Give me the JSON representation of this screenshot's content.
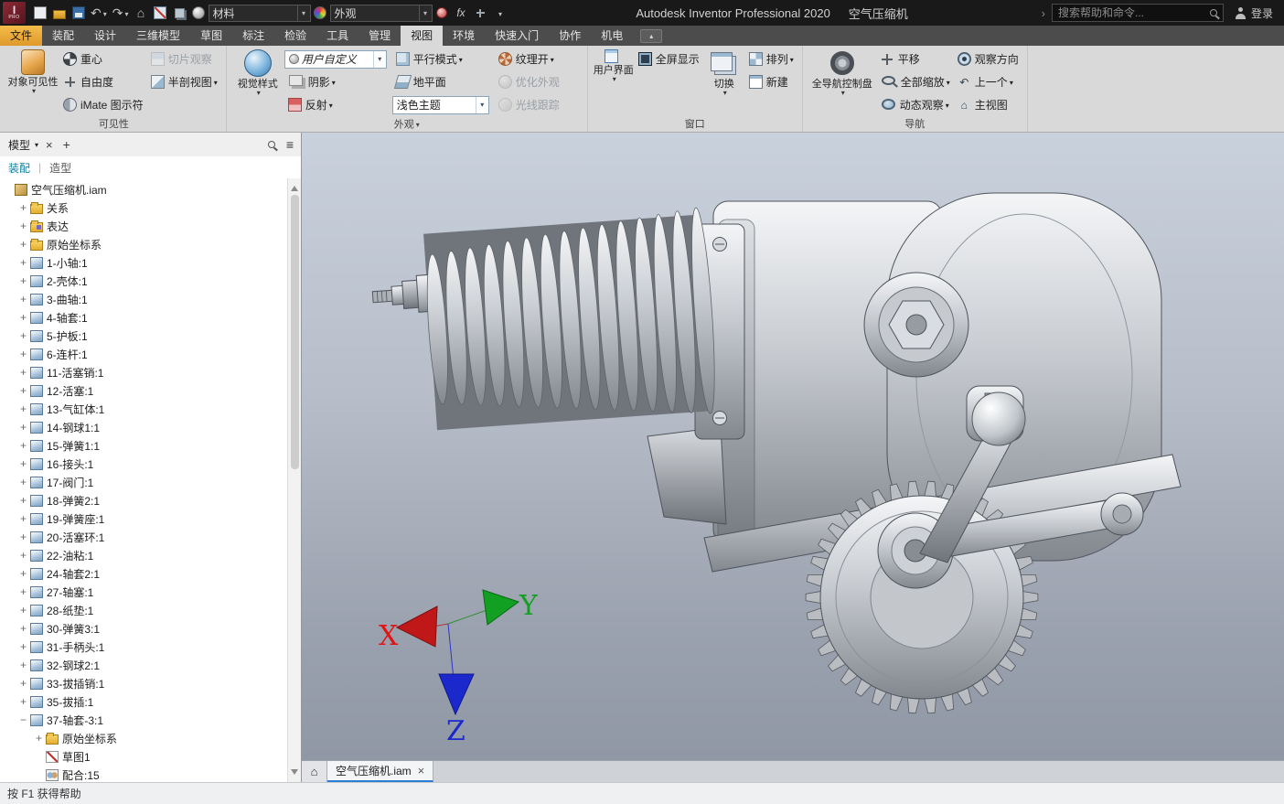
{
  "icons": {
    "home": "⌂",
    "undo": "↶",
    "redo": "↷",
    "fx": "fx",
    "hamburger": "≡",
    "close": "×",
    "add": "+",
    "chevron": "›",
    "collapse": "▴"
  },
  "colors": {
    "file_tab": "#e8a33d",
    "active_subtab": "#0a7e9e",
    "triad_x": "#e01616",
    "triad_y": "#12a022",
    "triad_z": "#1a28cc"
  },
  "titlebar": {
    "app_title": "Autodesk Inventor Professional 2020",
    "doc_title": "空气压缩机",
    "material_combo": "材料",
    "appearance_combo": "外观",
    "search_placeholder": "搜索帮助和命令...",
    "sign_in": "登录"
  },
  "ribbon": {
    "tabs": [
      "文件",
      "装配",
      "设计",
      "三维模型",
      "草图",
      "标注",
      "检验",
      "工具",
      "管理",
      "视图",
      "环境",
      "快速入门",
      "协作",
      "机电"
    ],
    "active_tab": "视图",
    "visibility": {
      "group_label": "可见性",
      "object_visibility": "对象可见性",
      "center_of_gravity": "重心",
      "degrees_of_freedom": "自由度",
      "imate_glyph": "iMate 图示符",
      "slice_view": "切片观察",
      "half_section": "半剖视图"
    },
    "appearance": {
      "group_label": "外观",
      "visual_style": "视觉样式",
      "user_defined": "用户自定义",
      "orthographic": "平行模式",
      "textures_on": "纹理开",
      "shadows": "阴影",
      "ground_plane": "地平面",
      "refine": "优化外观",
      "reflections": "反射",
      "theme": "浅色主题",
      "ray_tracing": "光线跟踪"
    },
    "window": {
      "group_label": "窗口",
      "user_interface": "用户界面",
      "full_screen": "全屏显示",
      "switch": "切换",
      "arrange": "排列",
      "new": "新建"
    },
    "navigate": {
      "group_label": "导航",
      "steering_wheel": "全导航控制盘",
      "pan": "平移",
      "zoom_all": "全部缩放",
      "orbit": "动态观察",
      "look_at": "观察方向",
      "previous": "上一个",
      "home_view": "主视图"
    }
  },
  "browser": {
    "panel_tab": "模型",
    "subtab_assembly": "装配",
    "subtab_modeling": "造型",
    "tree": [
      {
        "level": 0,
        "icon": "assembly",
        "exp": "",
        "label": "空气压缩机.iam"
      },
      {
        "level": 1,
        "icon": "folder",
        "exp": "+",
        "label": "关系"
      },
      {
        "level": 1,
        "icon": "folder-alt",
        "exp": "+",
        "label": "表达"
      },
      {
        "level": 1,
        "icon": "folder",
        "exp": "+",
        "label": "原始坐标系"
      },
      {
        "level": 1,
        "icon": "part",
        "exp": "+",
        "label": "1-小轴:1"
      },
      {
        "level": 1,
        "icon": "part",
        "exp": "+",
        "label": "2-壳体:1"
      },
      {
        "level": 1,
        "icon": "part",
        "exp": "+",
        "label": "3-曲轴:1"
      },
      {
        "level": 1,
        "icon": "part",
        "exp": "+",
        "label": "4-轴套:1"
      },
      {
        "level": 1,
        "icon": "part",
        "exp": "+",
        "label": "5-护板:1"
      },
      {
        "level": 1,
        "icon": "part",
        "exp": "+",
        "label": "6-连杆:1"
      },
      {
        "level": 1,
        "icon": "part",
        "exp": "+",
        "label": "11-活塞销:1"
      },
      {
        "level": 1,
        "icon": "part",
        "exp": "+",
        "label": "12-活塞:1"
      },
      {
        "level": 1,
        "icon": "part",
        "exp": "+",
        "label": "13-气缸体:1"
      },
      {
        "level": 1,
        "icon": "part",
        "exp": "+",
        "label": "14-钢球1:1"
      },
      {
        "level": 1,
        "icon": "part",
        "exp": "+",
        "label": "15-弹簧1:1"
      },
      {
        "level": 1,
        "icon": "part",
        "exp": "+",
        "label": "16-接头:1"
      },
      {
        "level": 1,
        "icon": "part",
        "exp": "+",
        "label": "17-阀门:1"
      },
      {
        "level": 1,
        "icon": "part",
        "exp": "+",
        "label": "18-弹簧2:1"
      },
      {
        "level": 1,
        "icon": "part",
        "exp": "+",
        "label": "19-弹簧座:1"
      },
      {
        "level": 1,
        "icon": "part",
        "exp": "+",
        "label": "20-活塞环:1"
      },
      {
        "level": 1,
        "icon": "part",
        "exp": "+",
        "label": "22-油粘:1"
      },
      {
        "level": 1,
        "icon": "part",
        "exp": "+",
        "label": "24-轴套2:1"
      },
      {
        "level": 1,
        "icon": "part",
        "exp": "+",
        "label": "27-轴塞:1"
      },
      {
        "level": 1,
        "icon": "part",
        "exp": "+",
        "label": "28-纸垫:1"
      },
      {
        "level": 1,
        "icon": "part",
        "exp": "+",
        "label": "30-弹簧3:1"
      },
      {
        "level": 1,
        "icon": "part",
        "exp": "+",
        "label": "31-手柄头:1"
      },
      {
        "level": 1,
        "icon": "part",
        "exp": "+",
        "label": "32-钢球2:1"
      },
      {
        "level": 1,
        "icon": "part",
        "exp": "+",
        "label": "33-拔插销:1"
      },
      {
        "level": 1,
        "icon": "part",
        "exp": "+",
        "label": "35-拔插:1"
      },
      {
        "level": 1,
        "icon": "part",
        "exp": "−",
        "label": "37-轴套-3:1"
      },
      {
        "level": 2,
        "icon": "folder",
        "exp": "+",
        "label": "原始坐标系"
      },
      {
        "level": 2,
        "icon": "sketch",
        "exp": "",
        "label": "草图1"
      },
      {
        "level": 2,
        "icon": "mate",
        "exp": "",
        "label": "配合:15"
      }
    ]
  },
  "viewport": {
    "doc_tab": "空气压缩机.iam",
    "triad_x": "X",
    "triad_y": "Y",
    "triad_z": "Z"
  },
  "statusbar": {
    "help": "按 F1 获得帮助"
  }
}
